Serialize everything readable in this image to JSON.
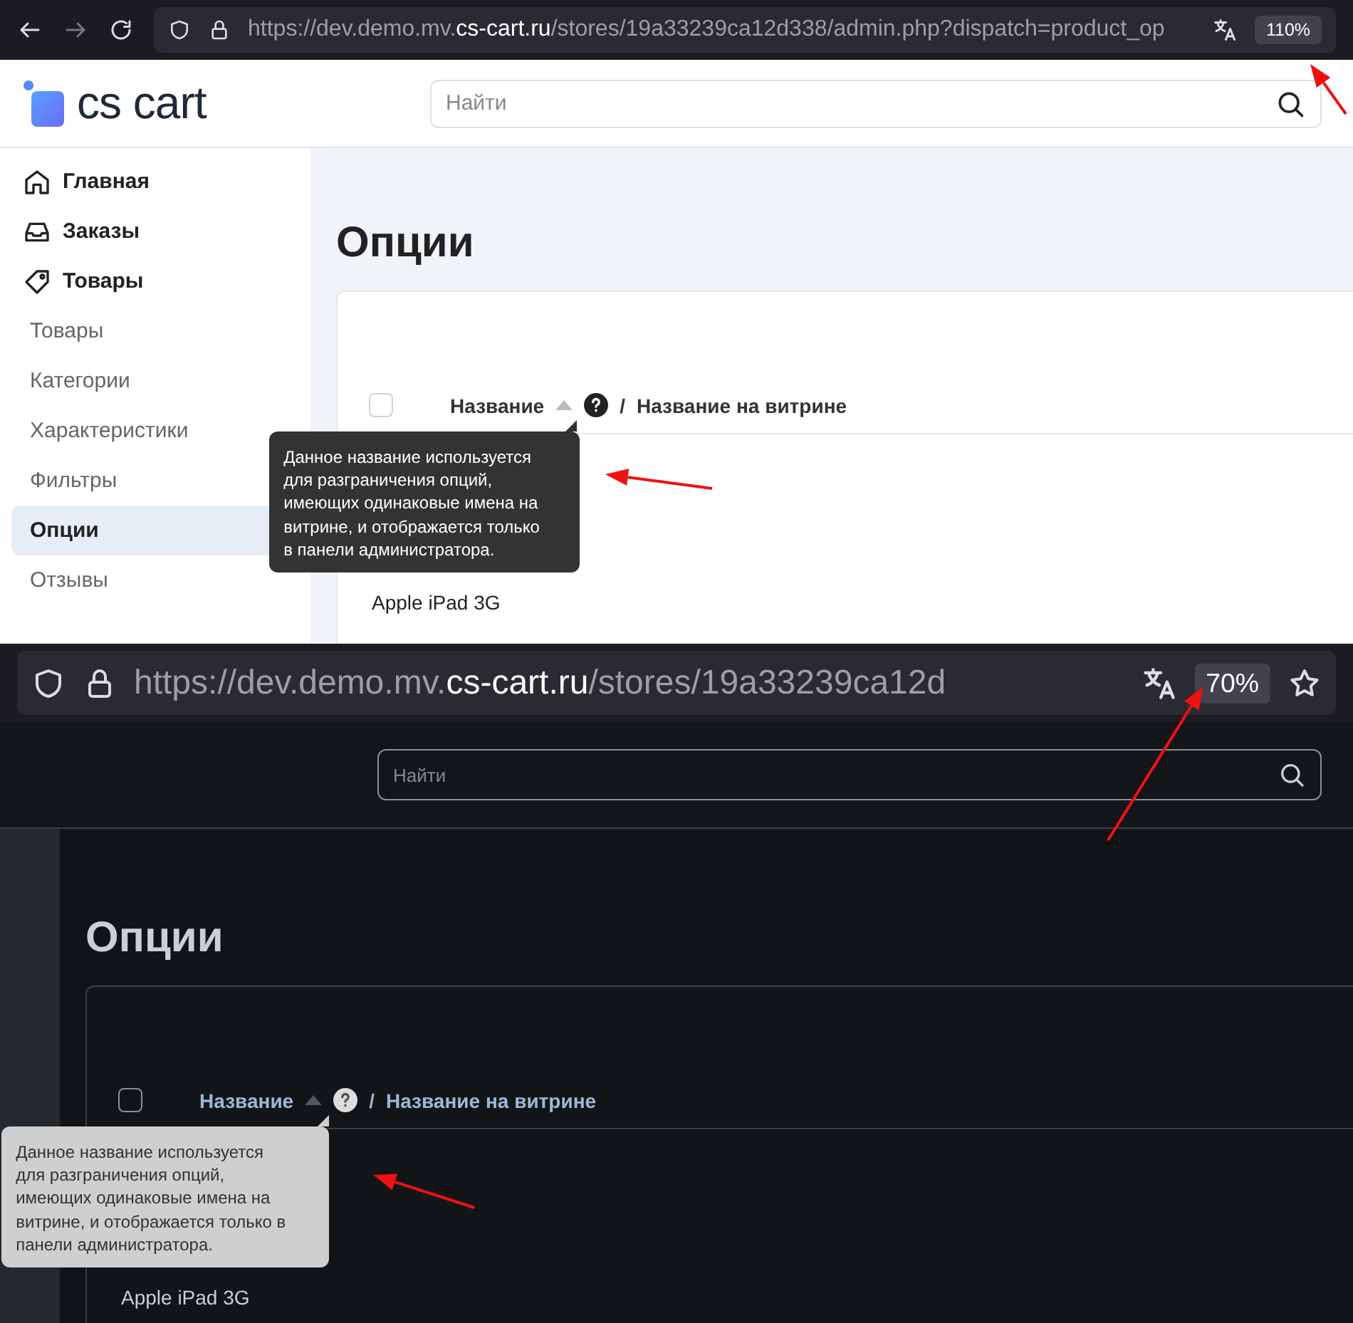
{
  "panels": [
    {
      "kind": "light",
      "browser": {
        "url_prefix": "https://dev.demo.mv.",
        "url_domain": "cs-cart.ru",
        "url_path": "/stores/19a33239ca12d338/admin.php?dispatch=product_op",
        "zoom": "110%"
      },
      "logo": "cs cart",
      "search": {
        "placeholder": "Найти"
      },
      "sidebar": {
        "sections": [
          {
            "label": "Главная"
          },
          {
            "label": "Заказы"
          },
          {
            "label": "Товары"
          }
        ],
        "links": [
          {
            "label": "Товары",
            "selected": false
          },
          {
            "label": "Категории",
            "selected": false
          },
          {
            "label": "Характеристики",
            "selected": false
          },
          {
            "label": "Фильтры",
            "selected": false
          },
          {
            "label": "Опции",
            "selected": true
          },
          {
            "label": "Отзывы",
            "selected": false
          }
        ]
      },
      "title": "Опции",
      "table": {
        "select_all": {
          "checked": false
        },
        "column_1": "Название",
        "separator": "/",
        "column_2": "Название на витрине",
        "rows": [
          "Apple iPad 3G"
        ]
      },
      "tooltip": "Данное название используется для разграничения опций, имеющих одинаковые имена на витрине, и отображается только в панели администратора."
    },
    {
      "kind": "dark",
      "browser": {
        "url_prefix": "https://dev.demo.mv.",
        "url_domain": "cs-cart.ru",
        "url_path": "/stores/19a33239ca12d",
        "zoom": "70%"
      },
      "search": {
        "placeholder": "Найти"
      },
      "title": "Опции",
      "table": {
        "select_all": {
          "checked": false
        },
        "column_1": "Название",
        "separator": "/",
        "column_2": "Название на витрине",
        "rows": [
          "Apple iPad 3G"
        ]
      },
      "tooltip": "Данное название используется для разграничения опций, имеющих одинаковые имена на витрине, и отображается только в панели администратора."
    }
  ]
}
